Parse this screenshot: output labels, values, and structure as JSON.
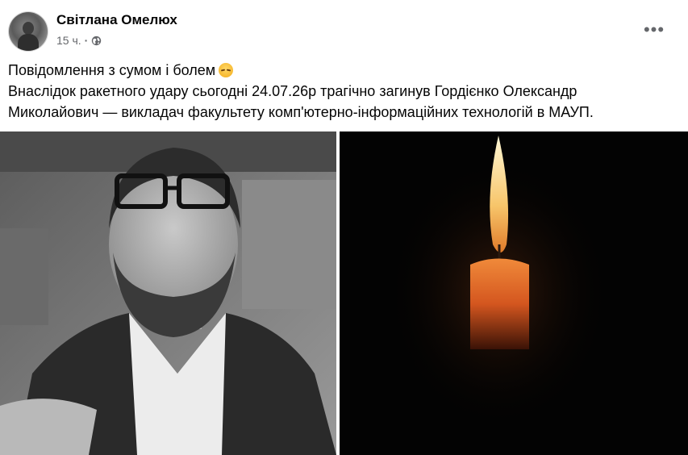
{
  "post": {
    "author": "Світлана Омелюх",
    "time": "15 ч.",
    "separator": "·",
    "more_label": "•••",
    "text_line1": "Повідомлення з сумом і болем",
    "text_line2": "Внаслідок ракетного удару сьогодні 24.07.26р  трагічно загинув Гордієнко Олександр",
    "text_line3": "Миколайович — викладач факультету комп'ютерно-інформаційних технологій в МАУП.",
    "emoji": "sad-face-emoji",
    "privacy_icon": "globe-icon"
  },
  "photos": {
    "left": "portrait-photo",
    "right": "candle-photo"
  },
  "colors": {
    "text": "#050505",
    "meta": "#65676b",
    "flame": "#f7c56a",
    "candle": "#e2662a"
  }
}
